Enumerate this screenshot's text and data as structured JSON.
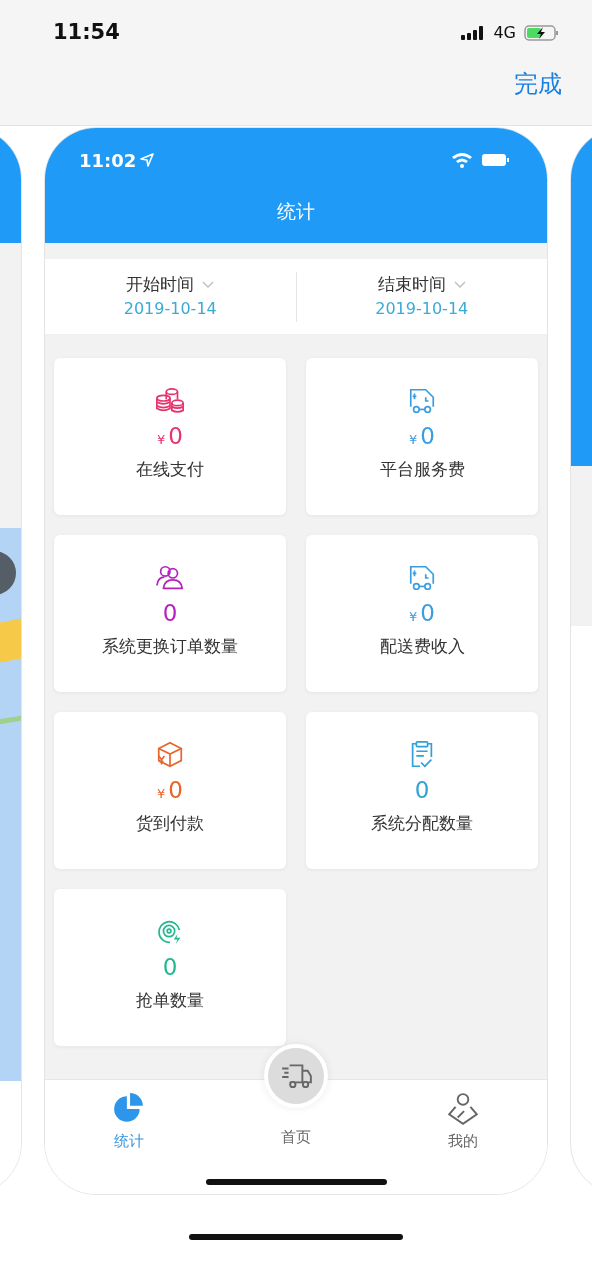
{
  "status_bar": {
    "time": "11:54",
    "network": "4G"
  },
  "done_button": "完成",
  "app": {
    "status_time": "11:02",
    "title": "统计",
    "date_filters": [
      {
        "label": "开始时间",
        "value": "2019-10-14"
      },
      {
        "label": "结束时间",
        "value": "2019-10-14"
      }
    ],
    "stats": [
      {
        "kind": "coins",
        "currency": "¥",
        "value": "0",
        "label": "在线支付",
        "color": "#e8336d"
      },
      {
        "kind": "truck",
        "currency": "¥",
        "value": "0",
        "label": "平台服务费",
        "color": "#3b9de0"
      },
      {
        "kind": "users",
        "value": "0",
        "label": "系统更换订单数量",
        "color": "#b620c0"
      },
      {
        "kind": "truck",
        "currency": "¥",
        "value": "0",
        "label": "配送费收入",
        "color": "#3b9de0"
      },
      {
        "kind": "box",
        "currency": "¥",
        "value": "0",
        "label": "货到付款",
        "color": "#e8642c"
      },
      {
        "kind": "clipboard",
        "value": "0",
        "label": "系统分配数量",
        "color": "#2fa0d8"
      },
      {
        "kind": "target",
        "value": "0",
        "label": "抢单数量",
        "color": "#22b88f"
      }
    ],
    "tabs": [
      {
        "kind": "pie",
        "label": "统计",
        "selected": true
      },
      {
        "kind": "home",
        "label": "首页",
        "selected": false
      },
      {
        "kind": "person",
        "label": "我的",
        "selected": false
      }
    ]
  },
  "side_cards": [
    {
      "kind": "map"
    },
    {
      "kind": "plain"
    }
  ]
}
